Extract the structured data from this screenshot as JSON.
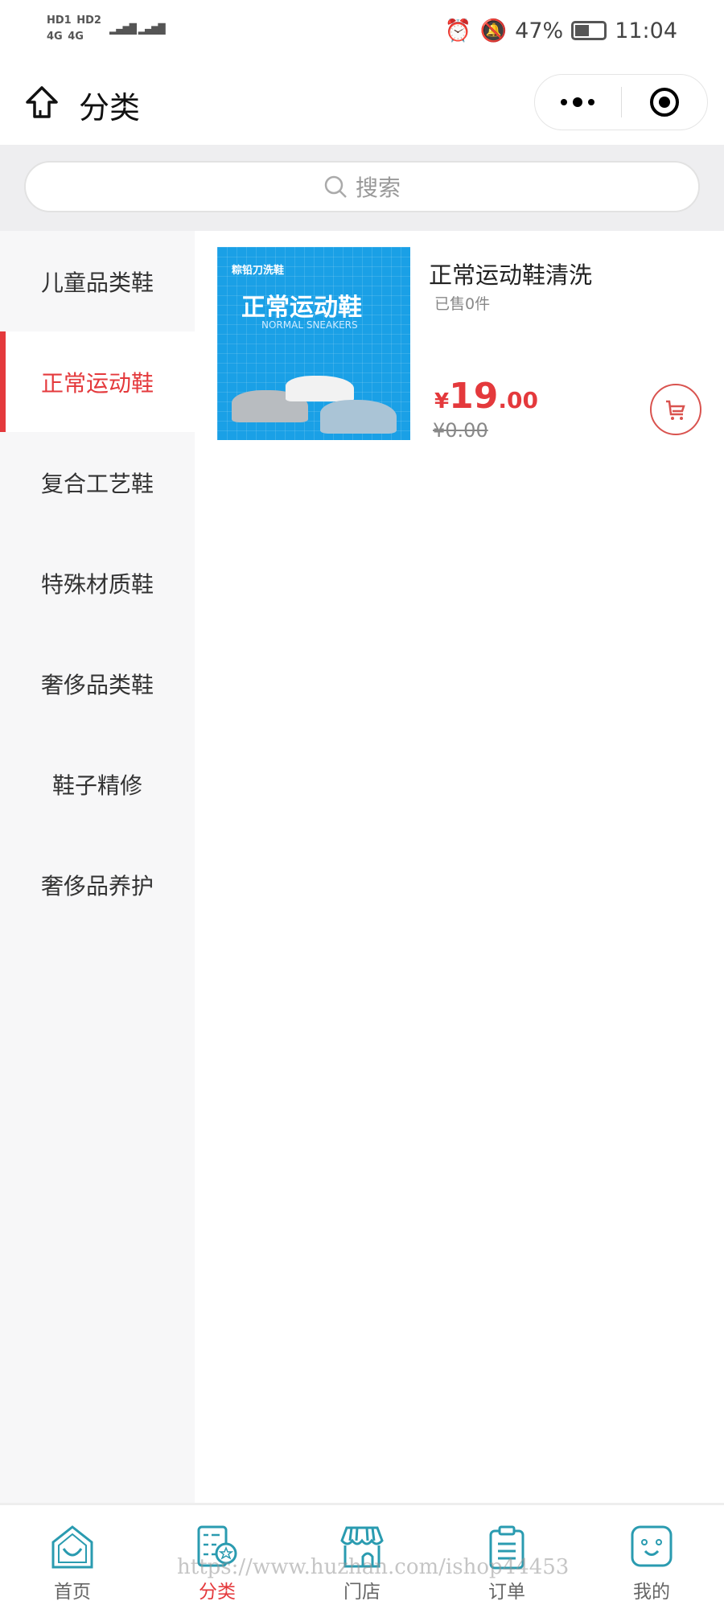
{
  "status_bar": {
    "sim": "HD1 HD2 4G 4G",
    "battery": "47%",
    "time": "11:04"
  },
  "header": {
    "title": "分类"
  },
  "search": {
    "placeholder": "搜索"
  },
  "categories": [
    {
      "label": "儿童品类鞋",
      "active": false
    },
    {
      "label": "正常运动鞋",
      "active": true
    },
    {
      "label": "复合工艺鞋",
      "active": false
    },
    {
      "label": "特殊材质鞋",
      "active": false
    },
    {
      "label": "奢侈品类鞋",
      "active": false
    },
    {
      "label": "鞋子精修",
      "active": false
    },
    {
      "label": "奢侈品养护",
      "active": false
    }
  ],
  "products": [
    {
      "name": "正常运动鞋清洗",
      "sold": "已售0件",
      "price_currency": "¥",
      "price_int": "19",
      "price_dec": ".00",
      "original_price": "¥0.00",
      "image": {
        "brand": "粽铅刀洗鞋",
        "headline": "正常运动鞋",
        "subtitle": "NORMAL SNEAKERS"
      }
    }
  ],
  "tabbar": [
    {
      "label": "首页",
      "icon": "home-icon"
    },
    {
      "label": "分类",
      "icon": "category-icon",
      "active": true
    },
    {
      "label": "门店",
      "icon": "store-icon"
    },
    {
      "label": "订单",
      "icon": "order-icon"
    },
    {
      "label": "我的",
      "icon": "profile-icon"
    }
  ],
  "watermark": "https://www.huzhan.com/ishop44453",
  "colors": {
    "accent": "#e4393c",
    "tab_icon": "#2a9bb0",
    "product_bg": "#1aa0e6"
  }
}
